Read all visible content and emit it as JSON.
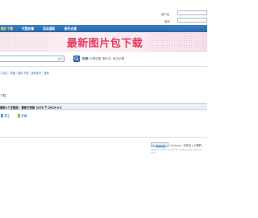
{
  "login": {
    "username_label": "用户名",
    "password_label": "密码"
  },
  "nav": {
    "items": [
      {
        "label": "图片下载",
        "active": true
      },
      {
        "label": "代理合集",
        "active": false
      },
      {
        "label": "活动通知",
        "active": false
      },
      {
        "label": "新手必看",
        "active": false
      }
    ]
  },
  "banner": {
    "title": "最新图片包下载"
  },
  "search": {
    "scope": "帖子",
    "hot_label": "热搜:",
    "hot_items": [
      "代理合集",
      "图片包",
      "新手必看"
    ]
  },
  "breadcrumb": {
    "text": "1 论坛 › 本版 › 图片下载 › 查看帖子 › 查看"
  },
  "section": {
    "label": "下载"
  },
  "thread": {
    "title": "最新1个正版图 - 最新已更新 2078 下 2019-4-1"
  },
  "options": [
    {
      "label": "楼主",
      "color": "#3a7fc6"
    },
    {
      "label": "收藏",
      "color": "#5aa83c"
    }
  ],
  "footer": {
    "button_label": "快速回复",
    "links": "| Archive | 手机版 | 小黑屋 |",
    "time_line": "GMT+8, 2019-4-1 23:11, Powered by Discuz! X3.2"
  },
  "colors": {
    "nav": "#2b67a8",
    "active_nav_text": "#ffe25a",
    "banner_title": "#e23b5c"
  }
}
